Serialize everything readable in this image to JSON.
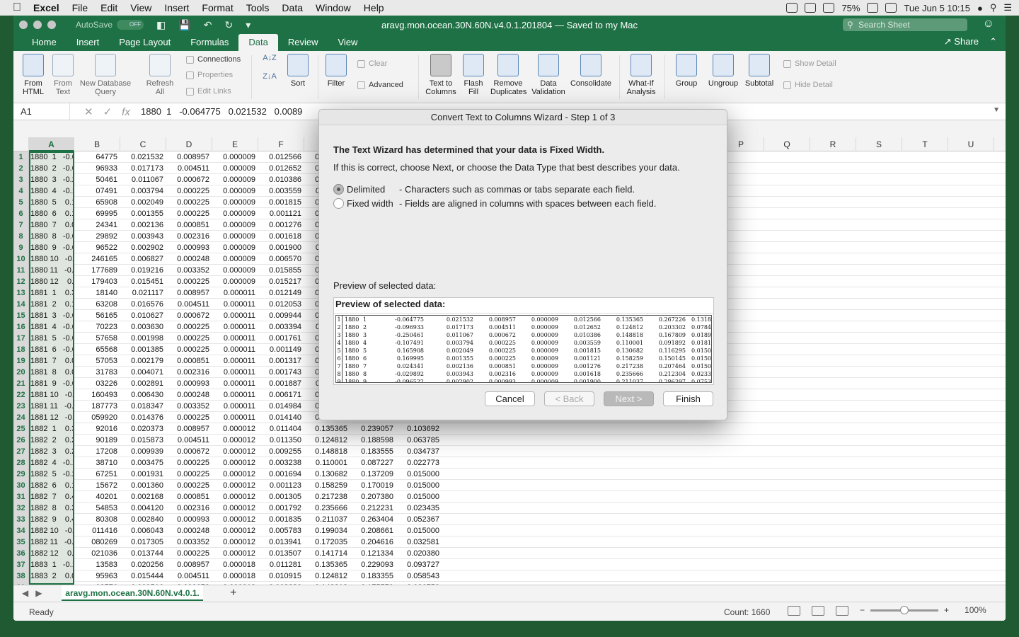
{
  "menubar": {
    "apple": "",
    "items": [
      "Excel",
      "File",
      "Edit",
      "View",
      "Insert",
      "Format",
      "Tools",
      "Data",
      "Window",
      "Help"
    ],
    "battery": "75%",
    "clock": "Tue Jun 5  10:15"
  },
  "titlebar": {
    "autosave": "AutoSave",
    "toggle": "OFF",
    "title": "aravg.mon.ocean.30N.60N.v4.0.1.201804  —  Saved to my Mac",
    "search_placeholder": "Search Sheet"
  },
  "tabs": [
    "Home",
    "Insert",
    "Page Layout",
    "Formulas",
    "Data",
    "Review",
    "View"
  ],
  "active_tab": "Data",
  "share": "Share",
  "ribbon": {
    "from_html": "From\nHTML",
    "from_text": "From\nText",
    "new_db_query": "New Database\nQuery",
    "refresh_all": "Refresh\nAll",
    "connections": "Connections",
    "properties": "Properties",
    "edit_links": "Edit Links",
    "sort": "Sort",
    "filter": "Filter",
    "clear": "Clear",
    "advanced": "Advanced",
    "text_to_columns": "Text to\nColumns",
    "flash_fill": "Flash\nFill",
    "remove_duplicates": "Remove\nDuplicates",
    "data_validation": "Data\nValidation",
    "consolidate": "Consolidate",
    "what_if": "What-If\nAnalysis",
    "group": "Group",
    "ungroup": "Ungroup",
    "subtotal": "Subtotal",
    "show_detail": "Show Detail",
    "hide_detail": "Hide Detail"
  },
  "formula_bar": {
    "name_box": "A1",
    "fx": "fx",
    "value": "1880  1   -0.064775   0.021532   0.0089"
  },
  "columns": [
    "A",
    "B",
    "C",
    "D",
    "E",
    "F",
    "G",
    "H",
    "I",
    "J",
    "K",
    "L",
    "M",
    "N",
    "O",
    "P",
    "Q",
    "R",
    "S",
    "T",
    "U"
  ],
  "rows": [
    {
      "n": "1",
      "a": "1880  1   -0.0",
      "b": "64775",
      "c": "0.021532",
      "d": "0.008957",
      "e": "0.000009",
      "f": "0.012566",
      "g": "0.135365"
    },
    {
      "n": "2",
      "a": "1880  2   -0.0",
      "b": "96933",
      "c": "0.017173",
      "d": "0.004511",
      "e": "0.000009",
      "f": "0.012652",
      "g": "0.124812"
    },
    {
      "n": "3",
      "a": "1880  3   -0.2",
      "b": "50461",
      "c": "0.011067",
      "d": "0.000672",
      "e": "0.000009",
      "f": "0.010386",
      "g": "0.148818"
    },
    {
      "n": "4",
      "a": "1880  4   -0.1",
      "b": "07491",
      "c": "0.003794",
      "d": "0.000225",
      "e": "0.000009",
      "f": "0.003559",
      "g": "0.110001"
    },
    {
      "n": "5",
      "a": "1880  5    0.1",
      "b": "65908",
      "c": "0.002049",
      "d": "0.000225",
      "e": "0.000009",
      "f": "0.001815",
      "g": "0.130682"
    },
    {
      "n": "6",
      "a": "1880  6    0.1",
      "b": "69995",
      "c": "0.001355",
      "d": "0.000225",
      "e": "0.000009",
      "f": "0.001121",
      "g": "0.158259"
    },
    {
      "n": "7",
      "a": "1880  7    0.0",
      "b": "24341",
      "c": "0.002136",
      "d": "0.000851",
      "e": "0.000009",
      "f": "0.001276",
      "g": "0.217238"
    },
    {
      "n": "8",
      "a": "1880  8   -0.0",
      "b": "29892",
      "c": "0.003943",
      "d": "0.002316",
      "e": "0.000009",
      "f": "0.001618",
      "g": "0.235666"
    },
    {
      "n": "9",
      "a": "1880  9   -0.0",
      "b": "96522",
      "c": "0.002902",
      "d": "0.000993",
      "e": "0.000009",
      "f": "0.001900",
      "g": "0.211037"
    },
    {
      "n": "10",
      "a": "1880 10   -0.",
      "b": "246165",
      "c": "0.006827",
      "d": "0.000248",
      "e": "0.000009",
      "f": "0.006570",
      "g": "0.199034"
    },
    {
      "n": "11",
      "a": "1880 11   -0.",
      "b": "177689",
      "c": "0.019216",
      "d": "0.003352",
      "e": "0.000009",
      "f": "0.015855",
      "g": "0.172035"
    },
    {
      "n": "12",
      "a": "1880 12    0.",
      "b": "179403",
      "c": "0.015451",
      "d": "0.000225",
      "e": "0.000009",
      "f": "0.015217",
      "g": "0.141714"
    },
    {
      "n": "13",
      "a": "1881  1    0.3",
      "b": "18140",
      "c": "0.021117",
      "d": "0.008957",
      "e": "0.000011",
      "f": "0.012149",
      "g": "0.135365"
    },
    {
      "n": "14",
      "a": "1881  2    0.1",
      "b": "63208",
      "c": "0.016576",
      "d": "0.004511",
      "e": "0.000011",
      "f": "0.012053",
      "g": "0.124812"
    },
    {
      "n": "15",
      "a": "1881  3   -0.0",
      "b": "56165",
      "c": "0.010627",
      "d": "0.000672",
      "e": "0.000011",
      "f": "0.009944",
      "g": "0.148818"
    },
    {
      "n": "16",
      "a": "1881  4   -0.0",
      "b": "70223",
      "c": "0.003630",
      "d": "0.000225",
      "e": "0.000011",
      "f": "0.003394",
      "g": "0.110001"
    },
    {
      "n": "17",
      "a": "1881  5   -0.0",
      "b": "57658",
      "c": "0.001998",
      "d": "0.000225",
      "e": "0.000011",
      "f": "0.001761",
      "g": "0.130682"
    },
    {
      "n": "18",
      "a": "1881  6   -0.0",
      "b": "65568",
      "c": "0.001385",
      "d": "0.000225",
      "e": "0.000011",
      "f": "0.001149",
      "g": "0.158259"
    },
    {
      "n": "19",
      "a": "1881  7    0.0",
      "b": "57053",
      "c": "0.002179",
      "d": "0.000851",
      "e": "0.000011",
      "f": "0.001317",
      "g": "0.217238"
    },
    {
      "n": "20",
      "a": "1881  8    0.0",
      "b": "31783",
      "c": "0.004071",
      "d": "0.002316",
      "e": "0.000011",
      "f": "0.001743",
      "g": "0.235666"
    },
    {
      "n": "21",
      "a": "1881  9   -0.0",
      "b": "03226",
      "c": "0.002891",
      "d": "0.000993",
      "e": "0.000011",
      "f": "0.001887",
      "g": "0.211037"
    },
    {
      "n": "22",
      "a": "1881 10   -0.",
      "b": "160493",
      "c": "0.006430",
      "d": "0.000248",
      "e": "0.000011",
      "f": "0.006171",
      "g": "0.199034"
    },
    {
      "n": "23",
      "a": "1881 11   -0.",
      "b": "187773",
      "c": "0.018347",
      "d": "0.003352",
      "e": "0.000011",
      "f": "0.014984",
      "g": "0.172035"
    },
    {
      "n": "24",
      "a": "1881 12   -0.",
      "b": "059920",
      "c": "0.014376",
      "d": "0.000225",
      "e": "0.000011",
      "f": "0.014140",
      "g": "0.141714",
      "h": "0.129988",
      "i": "0.017740"
    },
    {
      "n": "25",
      "a": "1882  1    0.3",
      "b": "92016",
      "c": "0.020373",
      "d": "0.008957",
      "e": "0.000012",
      "f": "0.011404",
      "g": "0.135365",
      "h": "0.239057",
      "i": "0.103692"
    },
    {
      "n": "26",
      "a": "1882  2    0.2",
      "b": "90189",
      "c": "0.015873",
      "d": "0.004511",
      "e": "0.000012",
      "f": "0.011350",
      "g": "0.124812",
      "h": "0.188598",
      "i": "0.063785"
    },
    {
      "n": "27",
      "a": "1882  3    0.2",
      "b": "17208",
      "c": "0.009939",
      "d": "0.000672",
      "e": "0.000012",
      "f": "0.009255",
      "g": "0.148818",
      "h": "0.183555",
      "i": "0.034737"
    },
    {
      "n": "28",
      "a": "1882  4   -0.1",
      "b": "38710",
      "c": "0.003475",
      "d": "0.000225",
      "e": "0.000012",
      "f": "0.003238",
      "g": "0.110001",
      "h": "0.087227",
      "i": "0.022773"
    },
    {
      "n": "29",
      "a": "1882  5   -0.2",
      "b": "67251",
      "c": "0.001931",
      "d": "0.000225",
      "e": "0.000012",
      "f": "0.001694",
      "g": "0.130682",
      "h": "0.137209",
      "i": "0.015000"
    },
    {
      "n": "30",
      "a": "1882  6    0.1",
      "b": "15672",
      "c": "0.001360",
      "d": "0.000225",
      "e": "0.000012",
      "f": "0.001123",
      "g": "0.158259",
      "h": "0.170019",
      "i": "0.015000"
    },
    {
      "n": "31",
      "a": "1882  7    0.4",
      "b": "40201",
      "c": "0.002168",
      "d": "0.000851",
      "e": "0.000012",
      "f": "0.001305",
      "g": "0.217238",
      "h": "0.207380",
      "i": "0.015000"
    },
    {
      "n": "32",
      "a": "1882  8    0.3",
      "b": "54853",
      "c": "0.004120",
      "d": "0.002316",
      "e": "0.000012",
      "f": "0.001792",
      "g": "0.235666",
      "h": "0.212231",
      "i": "0.023435"
    },
    {
      "n": "33",
      "a": "1882  9    0.4",
      "b": "80308",
      "c": "0.002840",
      "d": "0.000993",
      "e": "0.000012",
      "f": "0.001835",
      "g": "0.211037",
      "h": "0.263404",
      "i": "0.052367"
    },
    {
      "n": "34",
      "a": "1882 10   -0.",
      "b": "011416",
      "c": "0.006043",
      "d": "0.000248",
      "e": "0.000012",
      "f": "0.005783",
      "g": "0.199034",
      "h": "0.208661",
      "i": "0.015000"
    },
    {
      "n": "35",
      "a": "1882 11   -0.",
      "b": "080269",
      "c": "0.017305",
      "d": "0.003352",
      "e": "0.000012",
      "f": "0.013941",
      "g": "0.172035",
      "h": "0.204616",
      "i": "0.032581"
    },
    {
      "n": "36",
      "a": "1882 12    0.",
      "b": "021036",
      "c": "0.013744",
      "d": "0.000225",
      "e": "0.000012",
      "f": "0.013507",
      "g": "0.141714",
      "h": "0.121334",
      "i": "0.020380"
    },
    {
      "n": "37",
      "a": "1883  1   -0.1",
      "b": "13583",
      "c": "0.020256",
      "d": "0.008957",
      "e": "0.000018",
      "f": "0.011281",
      "g": "0.135365",
      "h": "0.229093",
      "i": "0.093727"
    },
    {
      "n": "38",
      "a": "1883  2    0.0",
      "b": "95963",
      "c": "0.015444",
      "d": "0.004511",
      "e": "0.000018",
      "f": "0.010915",
      "g": "0.124812",
      "h": "0.183355",
      "i": "0.058543"
    },
    {
      "n": "39",
      "a": "1883  3   -0.0",
      "b": "08776",
      "c": "0.009516",
      "d": "0.000672",
      "e": "0.000018",
      "f": "0.008826",
      "g": "0.148818",
      "h": "0.175570",
      "i": "0.026752"
    }
  ],
  "sheet_tab": "aravg.mon.ocean.30N.60N.v4.0.1.",
  "status": {
    "ready": "Ready",
    "count": "Count: 1660",
    "zoom": "100%",
    "zoom_fraction": 0.5
  },
  "dialog": {
    "title": "Convert Text to Columns Wizard - Step 1 of 3",
    "heading": "The Text Wizard has determined that your data is Fixed Width.",
    "sub": "If this is correct, choose Next, or choose the Data Type that best describes your data.",
    "opt_delimited": "Delimited",
    "opt_delimited_desc": "- Characters such as commas or tabs separate each field.",
    "opt_fixed": "Fixed width",
    "opt_fixed_desc": "- Fields are aligned in columns with spaces between each field.",
    "selected_option": "Delimited",
    "preview_label": "Preview of selected data:",
    "preview_title": "Preview of selected data:",
    "preview_rows": [
      [
        "1",
        "1880",
        "1",
        "-0.064775",
        "0.021532",
        "0.008957",
        "0.000009",
        "0.012566",
        "0.135365",
        "0.267226",
        "0.131861"
      ],
      [
        "2",
        "1880",
        "2",
        "-0.096933",
        "0.017173",
        "0.004511",
        "0.000009",
        "0.012652",
        "0.124812",
        "0.203302",
        "0.078490"
      ],
      [
        "3",
        "1880",
        "3",
        "-0.250461",
        "0.011067",
        "0.000672",
        "0.000009",
        "0.010386",
        "0.148818",
        "0.167809",
        "0.018991"
      ],
      [
        "4",
        "1880",
        "4",
        "-0.107491",
        "0.003794",
        "0.000225",
        "0.000009",
        "0.003559",
        "0.110001",
        "0.091892",
        "0.018108"
      ],
      [
        "5",
        "1880",
        "5",
        "0.165908",
        "0.002049",
        "0.000225",
        "0.000009",
        "0.001815",
        "0.130682",
        "0.116295",
        "0.015000"
      ],
      [
        "6",
        "1880",
        "6",
        "0.169995",
        "0.001355",
        "0.000225",
        "0.000009",
        "0.001121",
        "0.158259",
        "0.150145",
        "0.015000"
      ],
      [
        "7",
        "1880",
        "7",
        "0.024341",
        "0.002136",
        "0.000851",
        "0.000009",
        "0.001276",
        "0.217238",
        "0.207464",
        "0.015000"
      ],
      [
        "8",
        "1880",
        "8",
        "-0.029892",
        "0.003943",
        "0.002316",
        "0.000009",
        "0.001618",
        "0.235666",
        "0.212304",
        "0.023363"
      ],
      [
        "9",
        "1880",
        "9",
        "-0.096522",
        "0.002902",
        "0.000993",
        "0.000009",
        "0.001900",
        "0.211037",
        "0.286397",
        "0.075360"
      ]
    ],
    "cancel": "Cancel",
    "back": "< Back",
    "next": "Next >",
    "finish": "Finish"
  }
}
